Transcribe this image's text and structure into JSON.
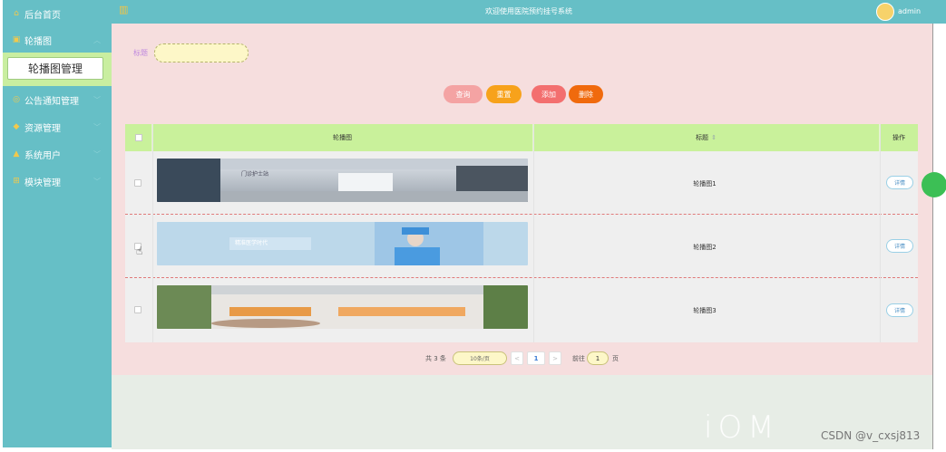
{
  "header": {
    "title": "欢迎使用医院预约挂号系统",
    "username": "admin",
    "logo_icon": "logo-icon",
    "avatar_icon": "avatar-icon"
  },
  "sidebar": {
    "items": [
      {
        "label": "后台首页",
        "icon": "home-icon"
      },
      {
        "label": "轮播图",
        "icon": "carousel-icon"
      },
      {
        "label": "公告通知管理",
        "icon": "notice-icon"
      },
      {
        "label": "资源管理",
        "icon": "resource-icon"
      },
      {
        "label": "系统用户",
        "icon": "user-icon"
      },
      {
        "label": "模块管理",
        "icon": "module-icon"
      }
    ],
    "active_sub": "轮播图管理"
  },
  "search": {
    "label": "标题",
    "value": "",
    "placeholder": ""
  },
  "buttons": {
    "query": "查询",
    "reset": "重置",
    "add": "添加",
    "delete": "删除"
  },
  "table": {
    "columns": [
      "轮播图",
      "标题",
      "操作"
    ],
    "sort_icon": "sort-icon",
    "rows": [
      {
        "title": "轮播图1",
        "action": "详情",
        "sign_text": "门诊护士站"
      },
      {
        "title": "轮播图2",
        "action": "详情",
        "banner_text": "精准医学时代"
      },
      {
        "title": "轮播图3",
        "action": "详情"
      }
    ]
  },
  "pagination": {
    "total": "共 3 条",
    "page_size": "10条/页",
    "prev": "<",
    "current": "1",
    "next": ">",
    "goto_prefix": "前往",
    "goto_value": "1",
    "goto_suffix": "页"
  },
  "watermark": {
    "csdn": "CSDN @v_cxsj813",
    "overlay": "iOM"
  },
  "colors": {
    "sidebar": "#66bfc6",
    "header": "#66bfc6",
    "panel": "#f6dede",
    "table_header": "#c9f19b",
    "query_btn": "#f4a3a3",
    "reset_btn": "#f7a21b",
    "add_btn": "#f36f6f",
    "delete_btn": "#f06a0d",
    "active_sub_bg": "#c9eea0"
  }
}
